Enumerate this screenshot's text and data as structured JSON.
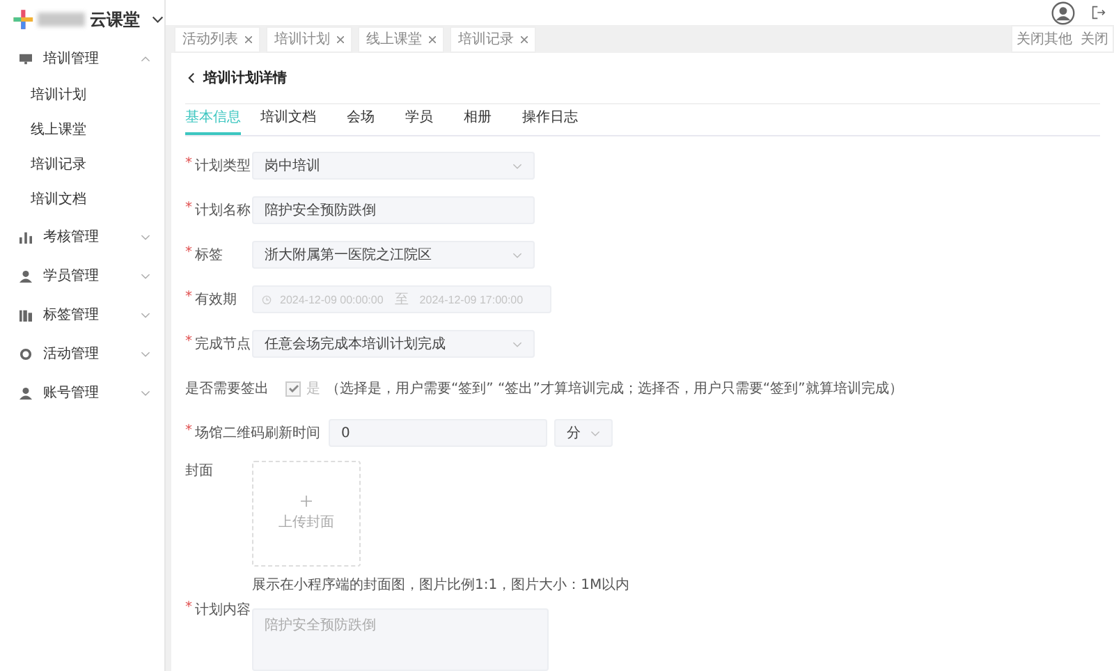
{
  "brand": {
    "name": "云课堂"
  },
  "sidebar": {
    "groups": [
      {
        "label": "培训管理",
        "expanded": true,
        "children": [
          {
            "label": "培训计划"
          },
          {
            "label": "线上课堂"
          },
          {
            "label": "培训记录"
          },
          {
            "label": "培训文档"
          }
        ]
      },
      {
        "label": "考核管理",
        "expanded": false
      },
      {
        "label": "学员管理",
        "expanded": false
      },
      {
        "label": "标签管理",
        "expanded": false
      },
      {
        "label": "活动管理",
        "expanded": false
      },
      {
        "label": "账号管理",
        "expanded": false
      }
    ]
  },
  "page_tabs": [
    {
      "label": "活动列表"
    },
    {
      "label": "培训计划"
    },
    {
      "label": "线上课堂"
    },
    {
      "label": "培训记录"
    }
  ],
  "tab_actions": [
    "关闭其他",
    "关闭"
  ],
  "page": {
    "title": "培训计划详情",
    "tabs": [
      {
        "label": "基本信息",
        "selected": true
      },
      {
        "label": "培训文档",
        "selected": false
      },
      {
        "label": "会场",
        "selected": false
      },
      {
        "label": "学员",
        "selected": false
      },
      {
        "label": "相册",
        "selected": false
      },
      {
        "label": "操作日志",
        "selected": false
      }
    ],
    "fields": [
      {
        "kind": "select",
        "label": "计划类型",
        "required_mark": "*",
        "value": "岗中培训"
      },
      {
        "kind": "text",
        "label": "计划名称",
        "required_mark": "*",
        "value": "陪护安全预防跌倒"
      },
      {
        "kind": "select",
        "label": "标签",
        "required_mark": "*",
        "value": "浙大附属第一医院之江院区"
      },
      {
        "kind": "daterange",
        "label": "有效期",
        "required_mark": "*",
        "start": "2024-12-09 00:00:00",
        "separator": "至",
        "end": "2024-12-09 17:00:00"
      },
      {
        "kind": "select",
        "label": "完成节点",
        "required_mark": "*",
        "value": "任意会场完成本培训计划完成"
      },
      {
        "kind": "checkbox",
        "label": "是否需要签出",
        "checked": true,
        "option": "是",
        "note": "（选择是，用户需要“签到” “签出”才算培训完成；选择否，用户只需要“签到”就算培训完成）"
      },
      {
        "kind": "number_unit",
        "label": "场馆二维码刷新时间",
        "required_mark": "*",
        "value": "0",
        "unit": "分"
      },
      {
        "kind": "upload",
        "label": "封面",
        "button": "上传封面",
        "hint": "展示在小程序端的封面图，图片比例1:1，图片大小：1M以内"
      },
      {
        "kind": "textarea",
        "label": "计划内容",
        "required_mark": "*",
        "placeholder": "陪护安全预防跌倒"
      }
    ]
  }
}
